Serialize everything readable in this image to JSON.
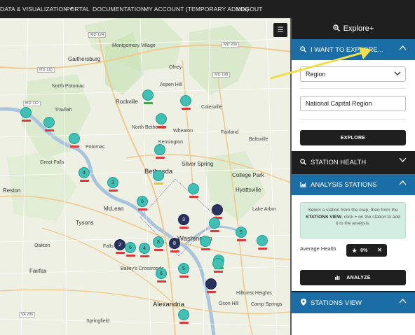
{
  "nav": {
    "items": [
      "DATA & VISUALIZATION",
      "PORTAL",
      "DOCUMENTATION",
      "MY ACCOUNT (TEMPORARY ADMIN)",
      "LOGOUT"
    ]
  },
  "map": {
    "layers_icon": "list-icon",
    "labels": {
      "gaithersburg": "Gaithersburg",
      "rockville": "Rockville",
      "olney": "Olney",
      "montgomery_village": "Montgomery Village",
      "colesville": "Colesville",
      "wheaton": "Wheaton",
      "aspen_hill": "Aspen Hill",
      "north_bethesda": "North Bethesda",
      "kensington": "Kensington",
      "fairland": "Fairland",
      "beltsville": "Beltsville",
      "north_potomac": "North Potomac",
      "potomac": "Potomac",
      "travilah": "Travilah",
      "great_falls": "Great Falls",
      "reston": "Reston",
      "bethesda": "Bethesda",
      "silver_spring": "Silver Spring",
      "college_park": "College Park",
      "hyattsville": "Hyattsville",
      "mclean": "McLean",
      "tysons": "Tysons",
      "oakton": "Oakton",
      "falls_church": "Falls",
      "washington": "Washington",
      "fairfax": "Fairfax",
      "baileys_crossroads": "Bailey's Crossroads",
      "alexandria": "Alexandria",
      "hillcrest_heights": "Hillcrest Heights",
      "oxon_hill": "Oxon Hill",
      "camp_springs": "Camp Springs",
      "lake_arbor": "Lake Arbor",
      "springfield": "Springfield",
      "md200": "MD 200",
      "md124": "MD 124",
      "md118": "MD 118",
      "md198": "MD 198",
      "md112": "MD 112",
      "va286": "VA 286"
    },
    "markers": [
      {
        "count": "",
        "tone": "teal",
        "bar": "green"
      },
      {
        "count": "",
        "tone": "teal",
        "bar": "red"
      },
      {
        "count": "",
        "tone": "teal",
        "bar": "red"
      },
      {
        "count": "",
        "tone": "teal",
        "bar": "red"
      },
      {
        "count": "",
        "tone": "teal",
        "bar": "red"
      },
      {
        "count": "",
        "tone": "teal",
        "bar": "red"
      },
      {
        "count": "",
        "tone": "teal",
        "bar": "red"
      },
      {
        "count": "4",
        "tone": "teal",
        "bar": "red"
      },
      {
        "count": "3",
        "tone": "teal",
        "bar": "red"
      },
      {
        "count": "",
        "tone": "teal",
        "bar": "yellow"
      },
      {
        "count": "6",
        "tone": "teal",
        "bar": "red"
      },
      {
        "count": "",
        "tone": "teal",
        "bar": "red"
      },
      {
        "count": "",
        "tone": "dark",
        "bar": "red"
      },
      {
        "count": "3",
        "tone": "dark",
        "bar": "red"
      },
      {
        "count": "",
        "tone": "teal",
        "bar": "red"
      },
      {
        "count": "5",
        "tone": "teal",
        "bar": "red"
      },
      {
        "count": "",
        "tone": "teal",
        "bar": "red"
      },
      {
        "count": "2",
        "tone": "dark",
        "bar": "red"
      },
      {
        "count": "6",
        "tone": "teal",
        "bar": "red"
      },
      {
        "count": "4",
        "tone": "teal",
        "bar": "red"
      },
      {
        "count": "8",
        "tone": "teal",
        "bar": "red"
      },
      {
        "count": "8",
        "tone": "dark",
        "bar": "red"
      },
      {
        "count": "",
        "tone": "teal",
        "bar": "red"
      },
      {
        "count": "6",
        "tone": "teal",
        "bar": "red"
      },
      {
        "count": "",
        "tone": "teal",
        "bar": "green"
      },
      {
        "count": "5",
        "tone": "teal",
        "bar": "red"
      },
      {
        "count": "",
        "tone": "teal",
        "bar": "red"
      },
      {
        "count": "",
        "tone": "dark",
        "bar": "red"
      },
      {
        "count": "",
        "tone": "teal",
        "bar": "red"
      }
    ]
  },
  "panel": {
    "title": "Explore+",
    "explore": {
      "header": "I WANT TO EXPLORE...",
      "category_select": "Region",
      "region_value": "National Capital Region",
      "explore_button": "EXPLORE"
    },
    "station_health": {
      "header": "STATION HEALTH"
    },
    "analysis": {
      "header": "ANALYSIS STATIONS",
      "info_pre": "Select a station from the map, then from the",
      "info_strong": "STATIONS VIEW",
      "info_post": ", click + on the station to add it to the analysis.",
      "avg_label": "Average Health",
      "avg_value": "0%",
      "analyze_button": "ANALYZE"
    },
    "stations_view": {
      "header": "STATIONS VIEW"
    }
  },
  "colors": {
    "nav_bg": "#1f1f1f",
    "accent_blue": "#1b6ea5",
    "marker_teal": "#3ec0b4",
    "marker_dark": "#28335e",
    "health_red": "#d63a3a",
    "health_green": "#3fa84a",
    "health_yellow": "#e3c32e",
    "info_green": "#d4ede3",
    "annotation_arrow": "#f2df4a"
  }
}
